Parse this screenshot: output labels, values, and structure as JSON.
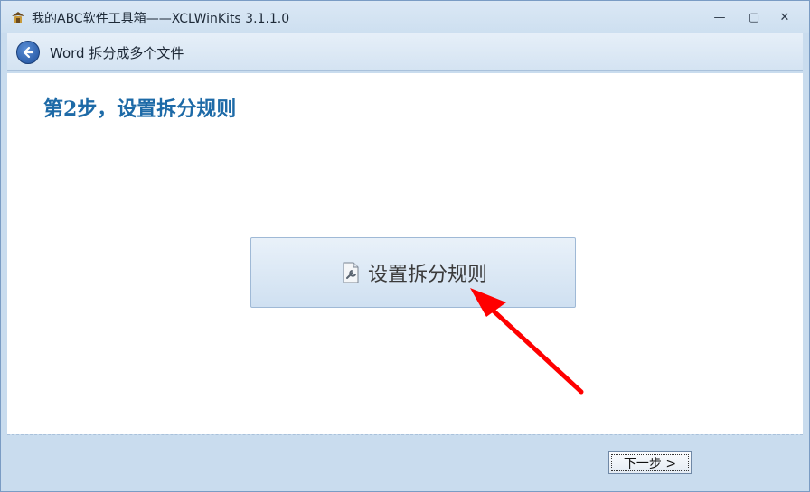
{
  "window": {
    "title": "我的ABC软件工具箱——XCLWinKits  3.1.1.0",
    "minimize_glyph": "—",
    "maximize_glyph": "▢",
    "close_glyph": "✕"
  },
  "header": {
    "back_icon": "back-arrow-icon",
    "title": "Word 拆分成多个文件"
  },
  "main": {
    "step_title": "第2步，设置拆分规则",
    "action_button": {
      "icon": "document-wrench-icon",
      "label": "设置拆分规则"
    },
    "annotation_arrow_color": "#ff0000"
  },
  "footer": {
    "next_label": "下一步 >"
  },
  "colors": {
    "accent": "#1d6aa7",
    "chrome": "#c9dcee"
  }
}
